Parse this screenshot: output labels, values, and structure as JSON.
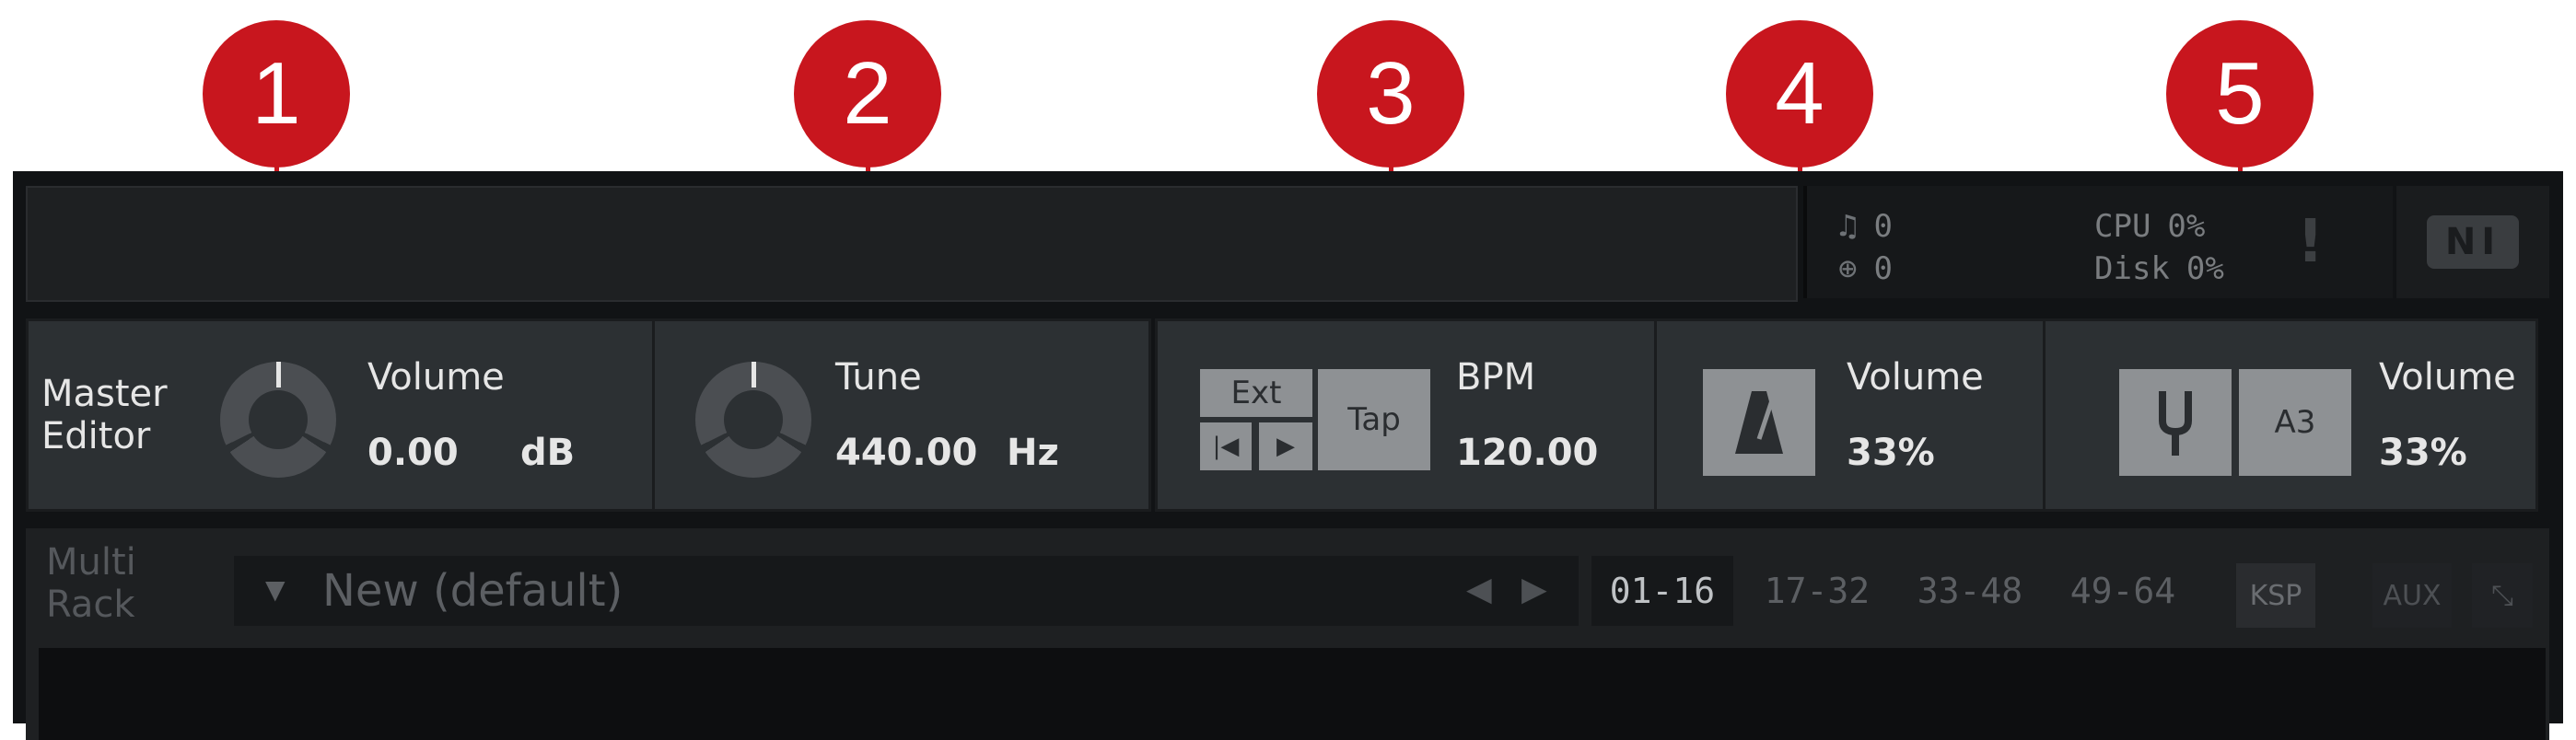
{
  "callouts": [
    "1",
    "2",
    "3",
    "4",
    "5"
  ],
  "stats": {
    "midi_value": "0",
    "mem_value": "0",
    "cpu_label": "CPU",
    "cpu_value": "0%",
    "disk_label": "Disk",
    "disk_value": "0%",
    "warning": "!"
  },
  "logo_text": "NI",
  "master": {
    "title_line1": "Master",
    "title_line2": "Editor",
    "volume_label": "Volume",
    "volume_value": "0.00",
    "volume_unit": "dB"
  },
  "tune": {
    "label": "Tune",
    "value": "440.00",
    "unit": "Hz"
  },
  "tempo": {
    "ext_label": "Ext",
    "tap_label": "Tap",
    "prev_symbol": "|◀",
    "play_symbol": "▶",
    "bpm_label": "BPM",
    "bpm_value": "120.00"
  },
  "metronome": {
    "icon": "metronome-icon",
    "volume_label": "Volume",
    "volume_value": "33%"
  },
  "reference_tone": {
    "icon": "tuning-fork-icon",
    "note": "A3",
    "volume_label": "Volume",
    "volume_value": "33%"
  },
  "multi_rack": {
    "title_line1": "Multi",
    "title_line2": "Rack",
    "preset_name": "New (default)",
    "pages": [
      "01-16",
      "17-32",
      "33-48",
      "49-64"
    ],
    "ksp_label": "KSP",
    "aux_label": "AUX"
  },
  "colors": {
    "callout": "#c8161e",
    "panel": "#2c3033",
    "button": "#8e9194"
  }
}
